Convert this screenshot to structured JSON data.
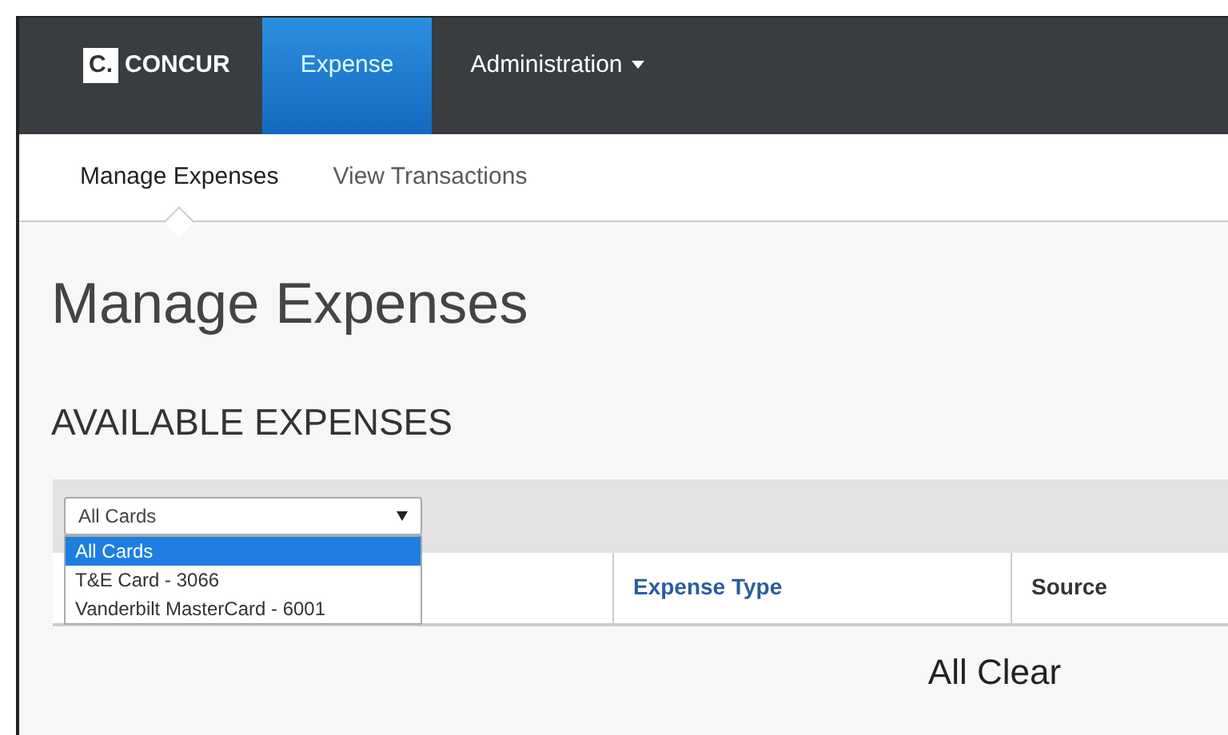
{
  "navbar": {
    "logo_mark": "C.",
    "logo_text": "CONCUR",
    "items": [
      {
        "label": "Expense",
        "selected": true,
        "dropdown": false
      },
      {
        "label": "Administration",
        "selected": false,
        "dropdown": true
      }
    ]
  },
  "subnav": {
    "items": [
      {
        "label": "Manage Expenses",
        "selected": true
      },
      {
        "label": "View Transactions",
        "selected": false
      }
    ]
  },
  "page_title": "Manage Expenses",
  "section_title": "AVAILABLE EXPENSES",
  "card_filter": {
    "value": "All Cards",
    "expanded": true,
    "options": [
      {
        "label": "All Cards",
        "selected": true
      },
      {
        "label": "T&E Card - 3066",
        "selected": false
      },
      {
        "label": "Vanderbilt MasterCard - 6001",
        "selected": false
      }
    ]
  },
  "table": {
    "columns": [
      {
        "label": "Expense Type",
        "sortable": true
      },
      {
        "label": "Source",
        "sortable": false
      }
    ],
    "empty_message": "All Clear"
  }
}
